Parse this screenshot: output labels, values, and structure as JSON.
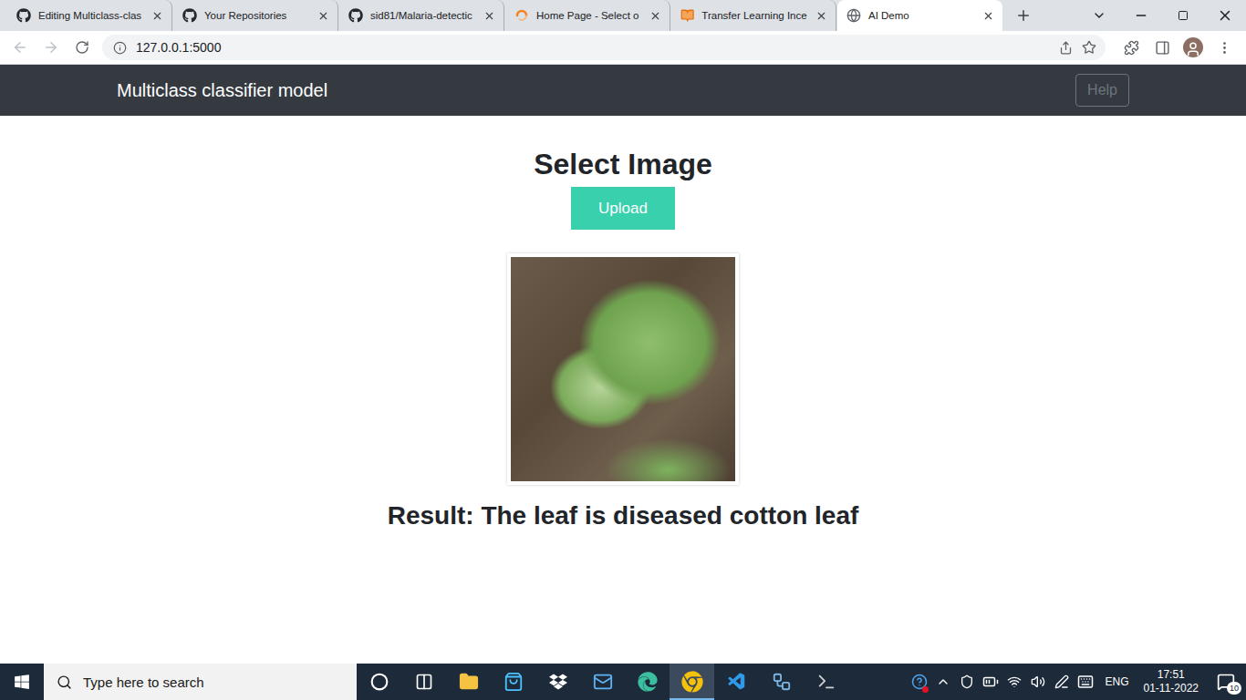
{
  "browser": {
    "tabs": [
      {
        "label": "Editing Multiclass-clas",
        "kind": "github",
        "selected": false
      },
      {
        "label": "Your Repositories",
        "kind": "github",
        "selected": false
      },
      {
        "label": "sid81/Malaria-detectic",
        "kind": "github",
        "selected": false
      },
      {
        "label": "Home Page - Select o",
        "kind": "spinner",
        "selected": false
      },
      {
        "label": "Transfer Learning Ince",
        "kind": "book",
        "selected": false
      },
      {
        "label": "AI Demo",
        "kind": "globe",
        "selected": true
      }
    ],
    "address": "127.0.0.1:5000"
  },
  "page": {
    "brand": "Multiclass classifier model",
    "help_button": "Help",
    "heading": "Select Image",
    "upload_button": "Upload",
    "result": "Result: The leaf is diseased cotton leaf"
  },
  "taskbar": {
    "search_placeholder": "Type here to search",
    "apps": [
      {
        "kind": "cortana",
        "selected": false
      },
      {
        "kind": "task-view",
        "selected": false
      },
      {
        "kind": "file-explorer",
        "selected": false
      },
      {
        "kind": "store",
        "selected": false
      },
      {
        "kind": "dropbox",
        "selected": false
      },
      {
        "kind": "mail",
        "selected": false
      },
      {
        "kind": "edge",
        "selected": false
      },
      {
        "kind": "chrome",
        "selected": true
      },
      {
        "kind": "vscode",
        "selected": false
      },
      {
        "kind": "network-app",
        "selected": false
      },
      {
        "kind": "terminal",
        "selected": false
      }
    ],
    "language": "ENG",
    "time": "17:51",
    "date": "01-11-2022",
    "notifications": "10"
  }
}
